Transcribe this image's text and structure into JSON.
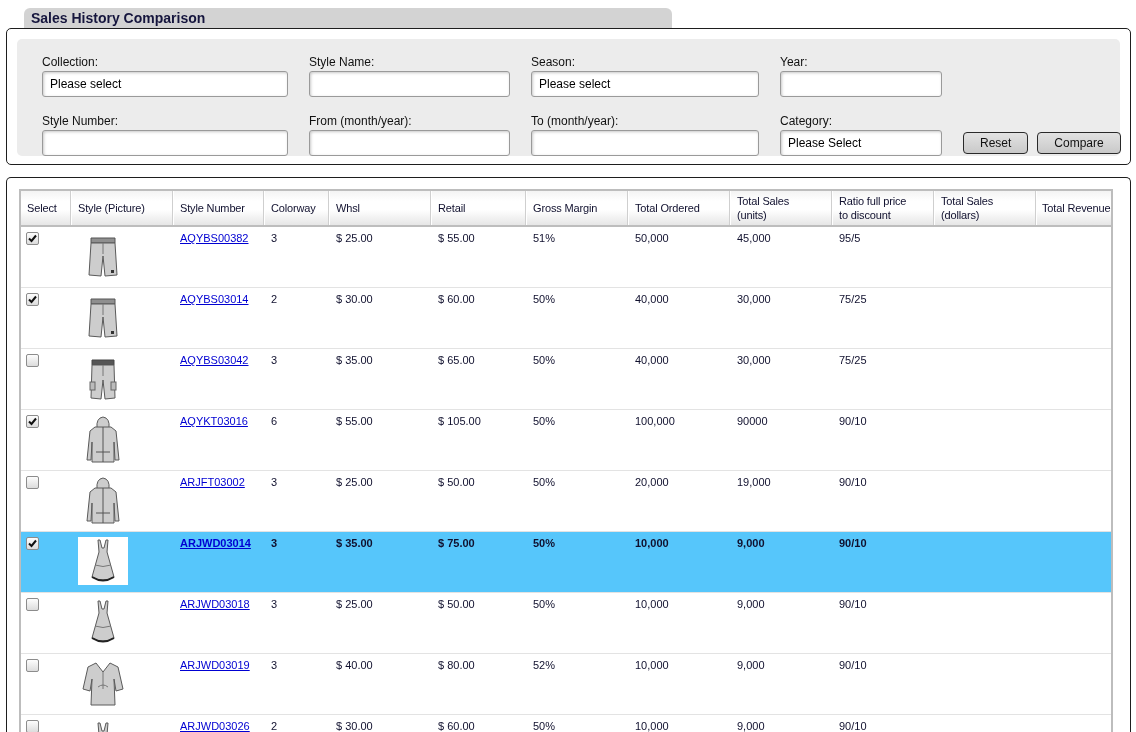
{
  "title": "Sales History Comparison",
  "filters": [
    {
      "label": "Collection:",
      "value": "Please select"
    },
    {
      "label": "Style Name:"
    },
    {
      "label": "Season:",
      "value": "Please select"
    },
    {
      "label": "Year:"
    },
    {
      "label": "Style Number:"
    },
    {
      "label": "From (month/year):"
    },
    {
      "label": "To (month/year):"
    },
    {
      "label": "Category:",
      "value": "Please Select"
    }
  ],
  "buttons": [
    "Reset",
    "Compare"
  ],
  "table": {
    "columns": [
      {
        "label": "Select",
        "kind": "checkbox"
      },
      {
        "label": "Style (Picture)",
        "kind": "picture"
      },
      {
        "label": "Style Number",
        "kind": "link"
      },
      {
        "label": "Colorway",
        "kind": "text"
      },
      {
        "label": "Whsl",
        "kind": "text"
      },
      {
        "label": "Retail",
        "kind": "text"
      },
      {
        "label": "Gross Margin",
        "kind": "text"
      },
      {
        "label": "Total Ordered",
        "kind": "text"
      },
      {
        "label": "Total Sales (units)",
        "kind": "text"
      },
      {
        "label": "Ratio full price to discount",
        "kind": "text"
      },
      {
        "label": "Total Sales (dollars)",
        "kind": "text"
      },
      {
        "label": "Total Revenue",
        "kind": "text"
      }
    ],
    "rows": [
      {
        "checked": true,
        "selected": false,
        "picture": {
          "kind": "shorts"
        },
        "values": [
          "AQYBS00382",
          "3",
          "$ 25.00",
          "$ 55.00",
          "51%",
          "50,000",
          "45,000",
          "95/5"
        ]
      },
      {
        "checked": true,
        "selected": false,
        "picture": {
          "kind": "shorts"
        },
        "values": [
          "AQYBS03014",
          "2",
          "$ 30.00",
          "$ 60.00",
          "50%",
          "40,000",
          "30,000",
          "75/25"
        ]
      },
      {
        "checked": false,
        "selected": false,
        "picture": {
          "kind": "cargo-shorts"
        },
        "values": [
          "AQYBS03042",
          "3",
          "$ 35.00",
          "$ 65.00",
          "50%",
          "40,000",
          "30,000",
          "75/25"
        ]
      },
      {
        "checked": true,
        "selected": false,
        "picture": {
          "kind": "hoodie"
        },
        "values": [
          "AQYKT03016",
          "6",
          "$ 55.00",
          "$ 105.00",
          "50%",
          "100,000",
          "90000",
          "90/10"
        ]
      },
      {
        "checked": false,
        "selected": false,
        "picture": {
          "kind": "hoodie"
        },
        "values": [
          "ARJFT03002",
          "3",
          "$ 25.00",
          "$ 50.00",
          "50%",
          "20,000",
          "19,000",
          "90/10"
        ]
      },
      {
        "checked": true,
        "selected": true,
        "picture": {
          "kind": "dress"
        },
        "values": [
          "ARJWD03014",
          "3",
          "$ 35.00",
          "$ 75.00",
          "50%",
          "10,000",
          "9,000",
          "90/10"
        ]
      },
      {
        "checked": false,
        "selected": false,
        "picture": {
          "kind": "dress"
        },
        "values": [
          "ARJWD03018",
          "3",
          "$ 25.00",
          "$ 50.00",
          "50%",
          "10,000",
          "9,000",
          "90/10"
        ]
      },
      {
        "checked": false,
        "selected": false,
        "picture": {
          "kind": "tunic"
        },
        "values": [
          "ARJWD03019",
          "3",
          "$ 40.00",
          "$ 80.00",
          "52%",
          "10,000",
          "9,000",
          "90/10"
        ]
      },
      {
        "checked": false,
        "selected": false,
        "picture": {
          "kind": "dress"
        },
        "values": [
          "ARJWD03026",
          "2",
          "$ 30.00",
          "$ 60.00",
          "50%",
          "10,000",
          "9,000",
          "90/10"
        ]
      }
    ]
  }
}
